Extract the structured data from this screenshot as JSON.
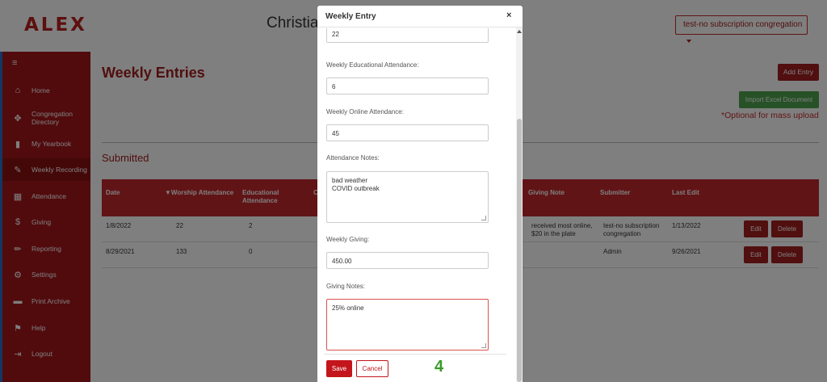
{
  "app": {
    "logo": "ALEX",
    "title": "Christia",
    "congregation_select": "test-no subscription congregation"
  },
  "sidebar": {
    "items": [
      {
        "label": "Home",
        "icon": "home-icon"
      },
      {
        "label": "Congregation Directory",
        "icon": "directory-icon"
      },
      {
        "label": "My Yearbook",
        "icon": "bookmark-icon"
      },
      {
        "label": "Weekly Recording",
        "icon": "edit-icon"
      },
      {
        "label": "Attendance",
        "icon": "calendar-icon"
      },
      {
        "label": "Giving",
        "icon": "dollar-icon"
      },
      {
        "label": "Reporting",
        "icon": "pencil-icon"
      },
      {
        "label": "Settings",
        "icon": "gear-icon"
      },
      {
        "label": "Print Archive",
        "icon": "folder-icon"
      },
      {
        "label": "Help",
        "icon": "flag-icon"
      },
      {
        "label": "Logout",
        "icon": "logout-icon"
      }
    ]
  },
  "main": {
    "heading": "Weekly Entries",
    "add_entry": "Add Entry",
    "import_excel": "Import Excel Document",
    "optional_note": "*Optional for mass upload",
    "submitted_heading": "Submitted",
    "table": {
      "headers": [
        "Date",
        "▼Worship Attendance",
        "Educational Attendance",
        "C",
        "Giving Note",
        "Submitter",
        "Last Edit"
      ],
      "rows": [
        {
          "date": "1/8/2022",
          "worship": "22",
          "educational": "2",
          "giving_note": "received most online, $20 in the plate",
          "submitter": "test-no subscription congregation",
          "last_edit": "1/13/2022",
          "edit": "Edit",
          "delete": "Delete"
        },
        {
          "date": "8/29/2021",
          "worship": "133",
          "educational": "0",
          "giving_note": "",
          "submitter": "Admin",
          "last_edit": "9/26/2021",
          "edit": "Edit",
          "delete": "Delete"
        }
      ]
    }
  },
  "modal": {
    "title": "Weekly Entry",
    "close": "×",
    "top_value": "22",
    "educational_label": "Weekly Educational Attendance:",
    "educational_value": "6",
    "online_label": "Weekly Online Attendance:",
    "online_value": "45",
    "notes_label": "Attendance Notes:",
    "notes_line1": "bad weather",
    "notes_line2": "COVID outbreak",
    "giving_label": "Weekly Giving:",
    "giving_value": "450.00",
    "giving_notes_label": "Giving Notes:",
    "giving_notes_value": "25% online",
    "save": "Save",
    "cancel": "Cancel",
    "step": "4"
  }
}
